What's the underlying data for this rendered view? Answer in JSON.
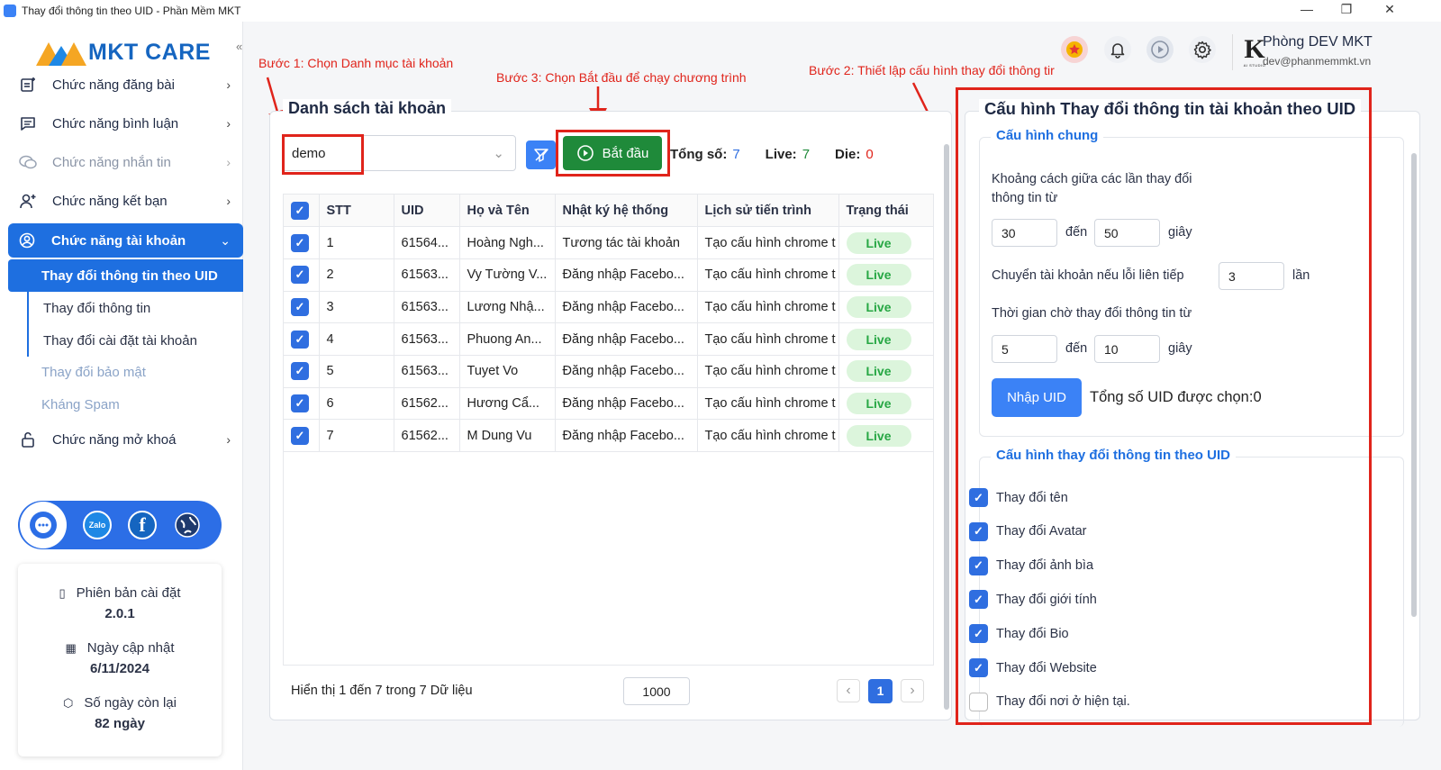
{
  "window": {
    "title": "Thay đổi thông tin theo UID - Phần Mềm MKT",
    "minimize": "—",
    "maximize": "❐",
    "close": "✕"
  },
  "brand": {
    "logo_text": "MKT CARE",
    "collapse_glyph": "«"
  },
  "sidebar": {
    "items": [
      {
        "label": "Chức năng đăng bài",
        "icon": "post-add-icon"
      },
      {
        "label": "Chức năng bình luận",
        "icon": "comment-icon"
      },
      {
        "label": "Chức năng nhắn tin",
        "icon": "chat-icon"
      },
      {
        "label": "Chức năng kết bạn",
        "icon": "add-friend-icon"
      },
      {
        "label": "Chức năng tài khoản",
        "icon": "account-icon"
      },
      {
        "label": "Chức năng mở khoá",
        "icon": "unlock-icon"
      }
    ],
    "subitems": [
      {
        "label": "Thay đổi thông tin theo UID"
      },
      {
        "label": "Thay đổi thông tin"
      },
      {
        "label": "Thay đổi cài đặt tài khoản"
      },
      {
        "label": "Thay đổi bảo mật"
      },
      {
        "label": "Kháng Spam"
      }
    ],
    "social": {
      "zalo": "Zalo",
      "facebook": "f"
    },
    "info": {
      "version_label": "Phiên bản cài đặt",
      "version_value": "2.0.1",
      "update_label": "Ngày cập nhật",
      "update_value": "6/11/2024",
      "days_label": "Số ngày còn lại",
      "days_value": "82 ngày"
    }
  },
  "header": {
    "user_name": "Phòng DEV MKT",
    "user_email": "dev@phanmemmkt.vn",
    "avatar_letter": "K",
    "avatar_caption": "AI STUDIO"
  },
  "annotations": {
    "step1": "Bước 1: Chọn Danh mục tài khoản",
    "step2": "Bước 2: Thiết lập cấu hình thay đổi thông tir",
    "step3": "Bước 3: Chọn Bắt đầu để chạy chương trình"
  },
  "accounts": {
    "title": "Danh sách tài khoản",
    "category_value": "demo",
    "start_label": "Bắt đầu",
    "total_label": "Tổng số:",
    "total_value": "7",
    "live_label": "Live:",
    "live_value": "7",
    "die_label": "Die:",
    "die_value": "0",
    "columns": [
      "STT",
      "UID",
      "Họ và Tên",
      "Nhật ký hệ thống",
      "Lịch sử tiến trình",
      "Trạng thái"
    ],
    "rows": [
      {
        "stt": "1",
        "uid": "61564...",
        "name": "Hoàng Ngh...",
        "log": "Tương tác tài khoản",
        "history": "Tạo cấu hình chrome t",
        "status": "Live"
      },
      {
        "stt": "2",
        "uid": "61563...",
        "name": "Vy Tường V...",
        "log": "Đăng nhập Facebo...",
        "history": "Tạo cấu hình chrome t",
        "status": "Live"
      },
      {
        "stt": "3",
        "uid": "61563...",
        "name": "Lương Nhậ...",
        "log": "Đăng nhập Facebo...",
        "history": "Tạo cấu hình chrome t",
        "status": "Live"
      },
      {
        "stt": "4",
        "uid": "61563...",
        "name": "Phuong An...",
        "log": "Đăng nhập Facebo...",
        "history": "Tạo cấu hình chrome t",
        "status": "Live"
      },
      {
        "stt": "5",
        "uid": "61563...",
        "name": "Tuyet Vo",
        "log": "Đăng nhập Facebo...",
        "history": "Tạo cấu hình chrome t",
        "status": "Live"
      },
      {
        "stt": "6",
        "uid": "61562...",
        "name": "Hương Cẩ...",
        "log": "Đăng nhập Facebo...",
        "history": "Tạo cấu hình chrome t",
        "status": "Live"
      },
      {
        "stt": "7",
        "uid": "61562...",
        "name": "M Dung Vu",
        "log": "Đăng nhập Facebo...",
        "history": "Tạo cấu hình chrome t",
        "status": "Live"
      }
    ],
    "footer_text": "Hiển thị 1 đến 7 trong 7 Dữ liệu",
    "page_size": "1000",
    "current_page": "1"
  },
  "config": {
    "title": "Cấu hình Thay đổi thông tin tài khoản theo UID",
    "general_title": "Cấu hình chung",
    "interval_label": "Khoảng cách giữa các lần thay đổi thông tin từ",
    "interval_from": "30",
    "interval_to": "50",
    "to_label": "đến",
    "seconds_label": "giây",
    "switch_label": "Chuyển tài khoản nếu lỗi liên tiếp",
    "switch_value": "3",
    "times_label": "lần",
    "wait_label": "Thời gian chờ thay đổi thông tin từ",
    "wait_from": "5",
    "wait_to": "10",
    "import_uid_label": "Nhập UID",
    "uid_count_text": "Tổng số UID được chọn:0",
    "uid_section_title": "Cấu hình thay đổi thông tin theo UID",
    "options": [
      {
        "label": "Thay đổi tên",
        "checked": true
      },
      {
        "label": "Thay đổi Avatar",
        "checked": true
      },
      {
        "label": "Thay đổi ảnh bìa",
        "checked": true
      },
      {
        "label": "Thay đổi giới tính",
        "checked": true
      },
      {
        "label": "Thay đổi Bio",
        "checked": true
      },
      {
        "label": "Thay đổi Website",
        "checked": true
      },
      {
        "label": "Thay đổi nơi ở hiện tại.",
        "checked": false
      }
    ]
  },
  "colors": {
    "primary": "#1e6fe0",
    "start_button": "#1f8a3a",
    "annotation": "#e0241b",
    "live_bg": "#dcf5dc",
    "live_text": "#27a744"
  }
}
